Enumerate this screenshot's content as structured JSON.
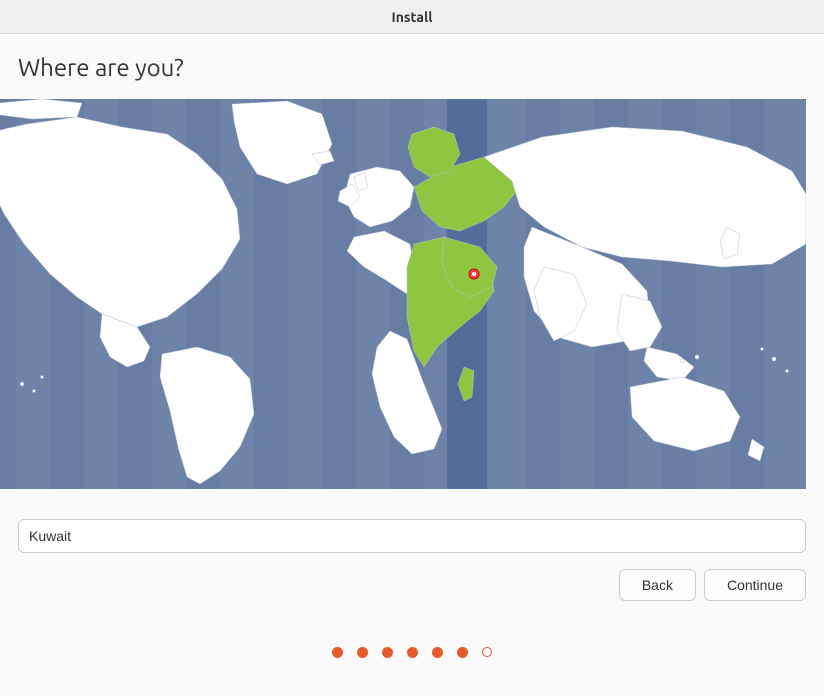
{
  "window": {
    "title": "Install"
  },
  "page": {
    "heading": "Where are you?"
  },
  "location": {
    "value": "Kuwait"
  },
  "buttons": {
    "back": "Back",
    "continue": "Continue"
  },
  "steps": {
    "total": 7,
    "current": 6
  },
  "colors": {
    "accent": "#e55b2c",
    "map_ocean": "#6e83a8",
    "map_selected": "#8ec641"
  }
}
